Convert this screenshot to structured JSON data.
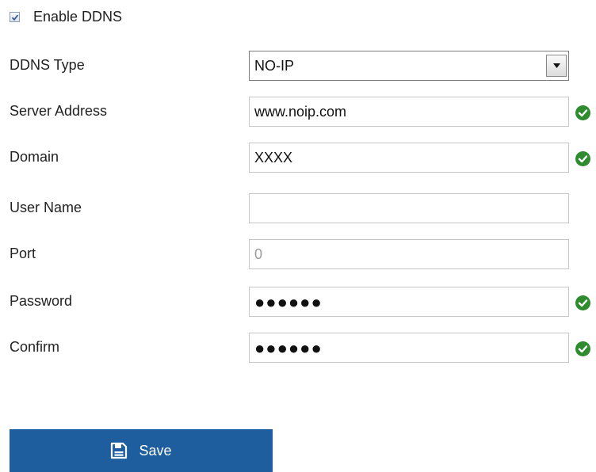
{
  "enable": {
    "label": "Enable DDNS",
    "checked": true
  },
  "fields": {
    "ddns_type": {
      "label": "DDNS Type",
      "value": "NO-IP"
    },
    "server_address": {
      "label": "Server Address",
      "value": "www.noip.com",
      "valid": true
    },
    "domain": {
      "label": "Domain",
      "value": "XXXX",
      "valid": true
    },
    "user_name": {
      "label": "User Name",
      "value": ""
    },
    "port": {
      "label": "Port",
      "value": "0"
    },
    "password": {
      "label": "Password",
      "value": "●●●●●●",
      "valid": true
    },
    "confirm": {
      "label": "Confirm",
      "value": "●●●●●●",
      "valid": true
    }
  },
  "save_button": {
    "label": "Save",
    "icon": "save-icon"
  },
  "colors": {
    "accent": "#1e5e9e",
    "valid": "#2e8b2e"
  }
}
